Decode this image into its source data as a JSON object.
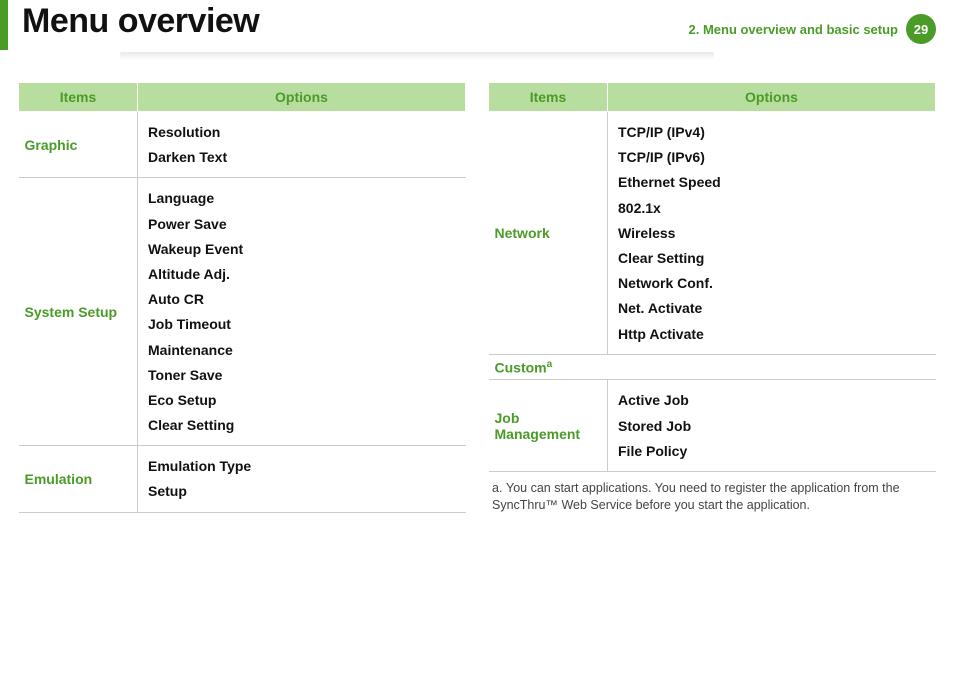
{
  "header": {
    "title": "Menu overview",
    "chapter": "2.  Menu overview and basic setup",
    "page_number": "29"
  },
  "table_headers": {
    "items": "Items",
    "options": "Options"
  },
  "left_table": [
    {
      "item": "Graphic",
      "options": [
        "Resolution",
        "Darken Text"
      ]
    },
    {
      "item": "System Setup",
      "options": [
        "Language",
        "Power Save",
        "Wakeup Event",
        "Altitude Adj.",
        "Auto CR",
        "Job Timeout",
        "Maintenance",
        "Toner Save",
        "Eco Setup",
        "Clear Setting"
      ]
    },
    {
      "item": "Emulation",
      "options": [
        "Emulation Type",
        "Setup"
      ]
    }
  ],
  "right_table": [
    {
      "item": "Network",
      "options": [
        "TCP/IP (IPv4)",
        "TCP/IP (IPv6)",
        "Ethernet Speed",
        "802.1x",
        "Wireless",
        "Clear Setting",
        "Network Conf.",
        "Net. Activate",
        "Http Activate"
      ]
    },
    {
      "item": "Custom",
      "sup": "a",
      "options": []
    },
    {
      "item": "Job Management",
      "options": [
        "Active Job",
        "Stored Job",
        "File Policy"
      ]
    }
  ],
  "footnote": {
    "mark": "a.",
    "text": "You can start applications. You need to register the application from the SyncThru™ Web Service before you start the application."
  }
}
